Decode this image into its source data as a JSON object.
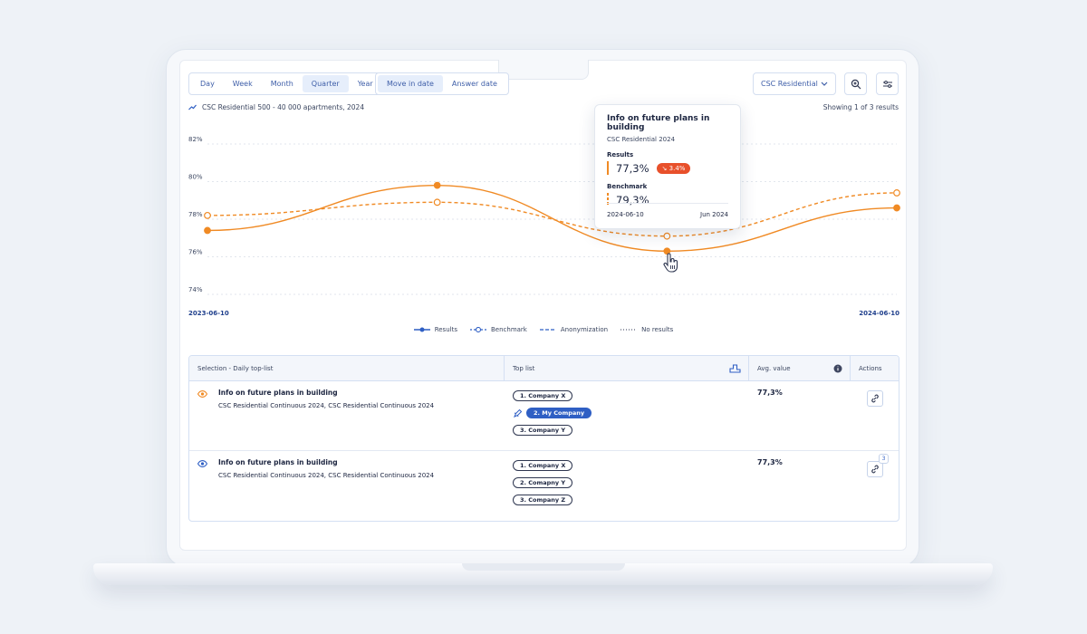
{
  "toolbar": {
    "period_tabs": [
      {
        "label": "Day",
        "active": false
      },
      {
        "label": "Week",
        "active": false
      },
      {
        "label": "Month",
        "active": false
      },
      {
        "label": "Quarter",
        "active": true
      },
      {
        "label": "Year",
        "active": false
      }
    ],
    "date_tabs": [
      {
        "label": "Move in date",
        "active": true
      },
      {
        "label": "Answer date",
        "active": false
      }
    ],
    "dropdown_value": "CSC Residential",
    "zoom_icon": "zoom-in-icon",
    "filter_icon": "filter-sliders-icon"
  },
  "chart_header": {
    "series_label": "CSC Residential 500 - 40 000 apartments, 2024",
    "showing": "Showing 1 of 3 results"
  },
  "chart_data": {
    "type": "line",
    "x": [
      "2023-06-10",
      "2023-12",
      "2024-06-10",
      "2024-06-10 end"
    ],
    "x_tick_labels": [
      "2023-06-10",
      "2024-06-10"
    ],
    "y_ticks": [
      "82%",
      "80%",
      "78%",
      "76%",
      "74%"
    ],
    "ylim": [
      74,
      82
    ],
    "series": [
      {
        "name": "Results",
        "style": "solid",
        "color": "#f08a24",
        "values": [
          77.4,
          79.8,
          76.3,
          78.6
        ]
      },
      {
        "name": "Benchmark",
        "style": "dashed",
        "color": "#f08a24",
        "values": [
          78.2,
          78.9,
          77.1,
          79.4
        ]
      }
    ],
    "grid": true,
    "legend_position": "bottom"
  },
  "legend": {
    "results": "Results",
    "benchmark": "Benchmark",
    "anonymization": "Anonymization",
    "no_results": "No results"
  },
  "tooltip": {
    "title": "Info on future plans in building",
    "subtitle": "CSC Residential 2024",
    "results_label": "Results",
    "results_value": "77,3%",
    "change_badge": "3.4%",
    "benchmark_label": "Benchmark",
    "benchmark_value": "79,3%",
    "date": "2024-06-10",
    "period": "Jun 2024"
  },
  "table": {
    "headers": {
      "selection": "Selection - Daily top-list",
      "top_list": "Top list",
      "avg_value": "Avg. value",
      "actions": "Actions"
    },
    "rows": [
      {
        "title": "Info on future plans in building",
        "subtitle": "CSC Residential Continuous 2024, CSC Residential Continuous 2024",
        "companies": [
          "1. Company X",
          "2. My Company",
          "3. Company Y"
        ],
        "avg": "77,3%",
        "eye_color": "#f08a24"
      },
      {
        "title": "Info on future plans in building",
        "subtitle": "CSC Residential Continuous 2024, CSC Residential Continuous 2024",
        "companies": [
          "1. Company X",
          "2. Comapny Y",
          "3. Company Z"
        ],
        "avg": "77,3%",
        "eye_color": "#2f5fc4",
        "link_count": "3"
      }
    ]
  },
  "colors": {
    "accent": "#f08a24",
    "brand_blue": "#2f5fc4",
    "negative": "#e8502b"
  }
}
